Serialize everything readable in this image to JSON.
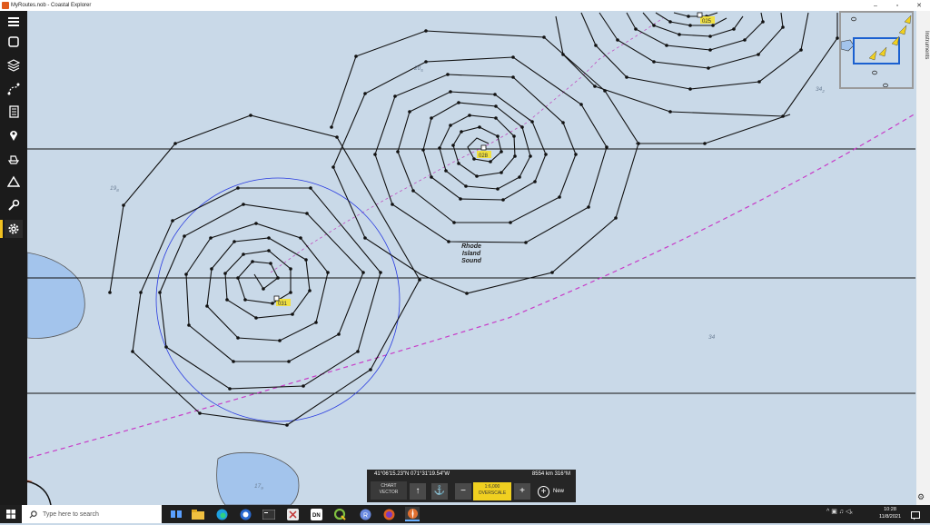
{
  "window": {
    "title": "MyRoutes.nob - Coastal Explorer",
    "minimize": "–",
    "maximize": "▫",
    "close": "✕"
  },
  "toolbar": {
    "items": [
      "menu-icon",
      "layers-window-icon",
      "layers-icon",
      "route-icon",
      "logbook-icon",
      "marker-icon",
      "vessel-icon",
      "triangle-icon",
      "wrench-icon",
      "settings-icon"
    ],
    "active": "settings-icon"
  },
  "instruments_tab": {
    "label": "Instruments"
  },
  "chart": {
    "place_label": [
      "Rhode",
      "Island",
      "Sound"
    ],
    "depths": [
      {
        "text": "19",
        "sub": "8"
      },
      {
        "text": "20",
        "sub": "5"
      },
      {
        "text": "34",
        "sub": "2"
      },
      {
        "text": "34",
        "sub": ""
      },
      {
        "text": "17",
        "sub": "9"
      }
    ],
    "waypoint_labels": [
      "025",
      "028",
      "031"
    ]
  },
  "statusbar": {
    "coordinates": "41°06'15.23\"N  071°31'19.54\"W",
    "range_bearing": "8554 km  316°M",
    "chart_type_title": "CHART",
    "chart_type_value": "VECTOR",
    "north_up": "↑",
    "boat_mode": "⚓",
    "zoom_out": "−",
    "zoom_in": "+",
    "scale_value": "1:6,000",
    "scale_mode": "OVERSCALE",
    "new_label": "New",
    "new_symbol": "+"
  },
  "taskbar": {
    "search_placeholder": "Type here to search",
    "apps": [
      "task-view",
      "file-explorer",
      "edge",
      "security",
      "terminal",
      "photos",
      "app-dn",
      "qgis",
      "app-r",
      "firefox",
      "coastal-explorer"
    ],
    "tray": "^ ▣ ♫ ◁ₓ",
    "time": "10:28",
    "date": "11/8/2021"
  }
}
